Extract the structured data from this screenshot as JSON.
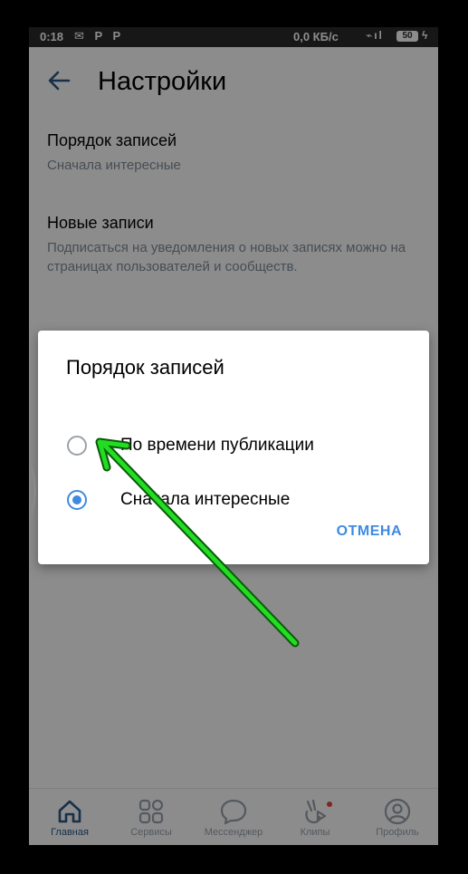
{
  "statusbar": {
    "time": "0:18",
    "network_speed": "0,0 КБ/с",
    "battery": "50"
  },
  "header": {
    "title": "Настройки"
  },
  "settings": [
    {
      "name": "Порядок записей",
      "desc": "Сначала интересные"
    },
    {
      "name": "Новые записи",
      "desc": "Подписаться на уведомления о новых записях можно на страницах пользователей и сообществ."
    }
  ],
  "dialog": {
    "title": "Порядок записей",
    "options": [
      {
        "label": "По времени публикации",
        "checked": false
      },
      {
        "label": "Сначала интересные",
        "checked": true
      }
    ],
    "cancel_label": "ОТМЕНА"
  },
  "bottomnav": [
    {
      "label": "Главная",
      "icon": "home-icon",
      "active": true
    },
    {
      "label": "Сервисы",
      "icon": "services-icon",
      "active": false
    },
    {
      "label": "Мессенджер",
      "icon": "messenger-icon",
      "active": false
    },
    {
      "label": "Клипы",
      "icon": "clips-icon",
      "active": false
    },
    {
      "label": "Профиль",
      "icon": "profile-icon",
      "active": false
    }
  ],
  "colors": {
    "accent": "#3f8ae0",
    "header_icon": "#2a5885",
    "annotation_arrow": "#22dd22"
  }
}
